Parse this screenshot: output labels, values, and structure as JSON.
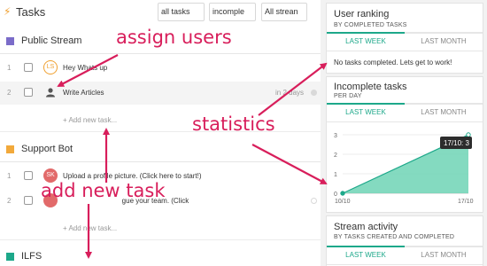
{
  "header": {
    "title": "Tasks",
    "filters": [
      {
        "value": "all tasks"
      },
      {
        "value": "incomple"
      },
      {
        "value": "All strean"
      }
    ]
  },
  "streams": [
    {
      "name": "Public Stream",
      "color": "#7b6cc9",
      "tasks": [
        {
          "num": "1",
          "avatar": "LS",
          "text": "Hey Whats up",
          "days": ""
        },
        {
          "num": "2",
          "avatar": "",
          "text": "Write Articles",
          "days": "in 2 days"
        }
      ],
      "add_label": "+ Add new task..."
    },
    {
      "name": "Support Bot",
      "color": "#f2a93b",
      "tasks": [
        {
          "num": "1",
          "avatar": "SK",
          "text": "Upload a profile picture. (Click here to start!)",
          "days": ""
        },
        {
          "num": "2",
          "avatar": "",
          "text": "                              gue your team. (Click",
          "days": ""
        }
      ],
      "add_label": "+ Add new task..."
    },
    {
      "name": "ILFS",
      "color": "#1da88a",
      "tasks": [],
      "add_label": ""
    }
  ],
  "widgets": {
    "ranking": {
      "title": "User ranking",
      "subtitle": "BY COMPLETED TASKS",
      "tab_active": "LAST WEEK",
      "tab_inactive": "LAST MONTH",
      "message": "No tasks completed. Lets get to work!"
    },
    "incomplete": {
      "title": "Incomplete tasks",
      "subtitle": "PER DAY",
      "tab_active": "LAST WEEK",
      "tab_inactive": "LAST MONTH",
      "tooltip": "17/10: 3"
    },
    "activity": {
      "title": "Stream activity",
      "subtitle": "BY TASKS CREATED AND COMPLETED",
      "tab_active": "LAST WEEK",
      "tab_inactive": "LAST MONTH"
    }
  },
  "chart_data": {
    "type": "area",
    "x": [
      "10/10",
      "17/10"
    ],
    "series": [
      {
        "values": [
          0,
          3
        ]
      }
    ],
    "ylim": [
      0,
      3
    ],
    "yticks": [
      "0",
      "1",
      "2",
      "3"
    ],
    "xticks": [
      "10/10",
      "17/10"
    ],
    "color": "#6fd3b5"
  },
  "annotations": {
    "assign": "assign users",
    "stats": "statistics",
    "add": "add new task"
  },
  "colors": {
    "accent": "#1da88a",
    "annotation": "#d81e5b"
  }
}
